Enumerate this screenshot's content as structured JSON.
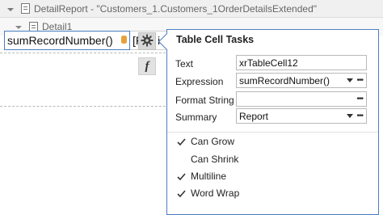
{
  "band_tree": {
    "detail_report_label": "DetailReport - \"Customers_1.Customers_1OrderDetailsExtended\"",
    "detail_label": "Detail1"
  },
  "cell": {
    "text": "sumRecordNumber()",
    "next_cell_text": "[F",
    "clipped_text": "ic"
  },
  "icons": {
    "gear": "gear-icon",
    "fx": "f",
    "database": "database-icon"
  },
  "popup": {
    "title": "Table Cell Tasks",
    "text_label": "Text",
    "text_value": "xrTableCell12",
    "expression_label": "Expression",
    "expression_value": "sumRecordNumber()",
    "format_label": "Format String",
    "format_value": "",
    "summary_label": "Summary",
    "summary_value": "Report",
    "checkboxes": [
      {
        "label": "Can Grow",
        "checked": true
      },
      {
        "label": "Can Shrink",
        "checked": false
      },
      {
        "label": "Multiline",
        "checked": true
      },
      {
        "label": "Word Wrap",
        "checked": true
      }
    ]
  },
  "colors": {
    "selection_border": "#4a7ec0",
    "db_icon": "#e8a13a"
  }
}
